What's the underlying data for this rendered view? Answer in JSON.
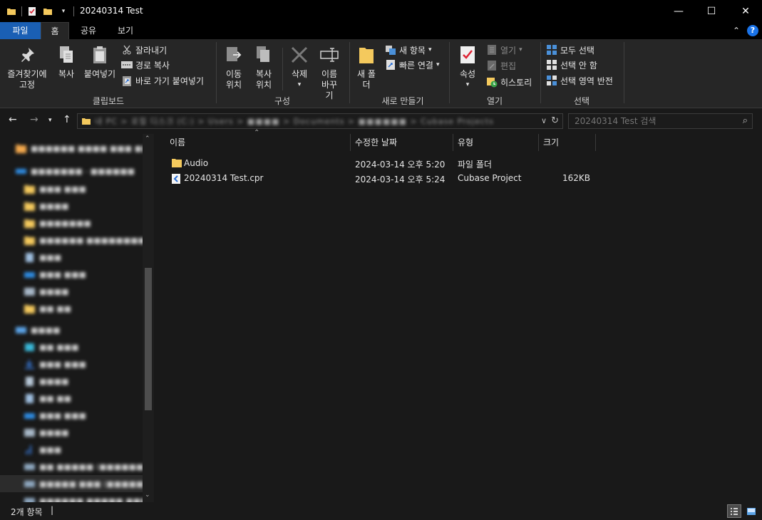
{
  "window": {
    "title": "20240314 Test",
    "minimize": "—",
    "maximize": "☐",
    "close": "✕"
  },
  "tabs": {
    "file": "파일",
    "home": "홈",
    "share": "공유",
    "view": "보기"
  },
  "ribbon": {
    "clipboard": {
      "label": "클립보드",
      "pin": "즐겨찾기에 고정",
      "copy": "복사",
      "paste": "붙여넣기",
      "cut": "잘라내기",
      "copy_path": "경로 복사",
      "paste_shortcut": "바로 가기 붙여넣기"
    },
    "organize": {
      "label": "구성",
      "move_to": "이동 위치",
      "copy_to": "복사 위치",
      "delete": "삭제",
      "rename": "이름 바꾸기"
    },
    "new": {
      "label": "새로 만들기",
      "new_folder": "새 폴더",
      "new_item": "새 항목",
      "easy_access": "빠른 연결"
    },
    "open": {
      "label": "열기",
      "properties": "속성",
      "open": "열기",
      "edit": "편집",
      "history": "히스토리"
    },
    "select": {
      "label": "선택",
      "select_all": "모두 선택",
      "select_none": "선택 안 함",
      "invert": "선택 영역 반전"
    }
  },
  "address": {
    "path": "내 PC > 로컬 디스크 (C:) > Users > ■■■■ > Documents > ■■■■■■ > Cubase Projects > ■■■■ > 20240314 Test",
    "search_placeholder": "20240314 Test 검색"
  },
  "navpane": {
    "items": [
      "■■■■■■ ■■■■ ■■■ ■■■■■■■",
      "■■■■■■■ - ■■■■■■",
      "■■■ ■■■",
      "■■■■",
      "■■■■■■■",
      "■■■■■■ ■■■■■■■■■■",
      "■■■",
      "■■■ ■■■",
      "■■■■",
      "■■ ■■",
      "■■■■",
      "■■ ■■■",
      "■■■ ■■■",
      "■■■■",
      "■■ ■■",
      "■■■ ■■■",
      "■■■■",
      "■■■",
      "■■ ■■■■■ (■■■■■■■ ■■■)",
      "■■■■■ ■■■ (■■■■■■■ ■■■)",
      "■■■■■■ ■■■■■ ■■■■"
    ]
  },
  "filelist": {
    "columns": {
      "name": "이름",
      "modified": "수정한 날짜",
      "type": "유형",
      "size": "크기"
    },
    "rows": [
      {
        "name": "Audio",
        "modified": "2024-03-14 오후 5:20",
        "type": "파일 폴더",
        "size": ""
      },
      {
        "name": "20240314 Test.cpr",
        "modified": "2024-03-14 오후 5:24",
        "type": "Cubase Project",
        "size": "162KB"
      }
    ]
  },
  "status": {
    "count": "2개 항목"
  },
  "colors": {
    "accent": "#1a5fb4",
    "folder": "#f4c95d",
    "background": "#191919"
  }
}
